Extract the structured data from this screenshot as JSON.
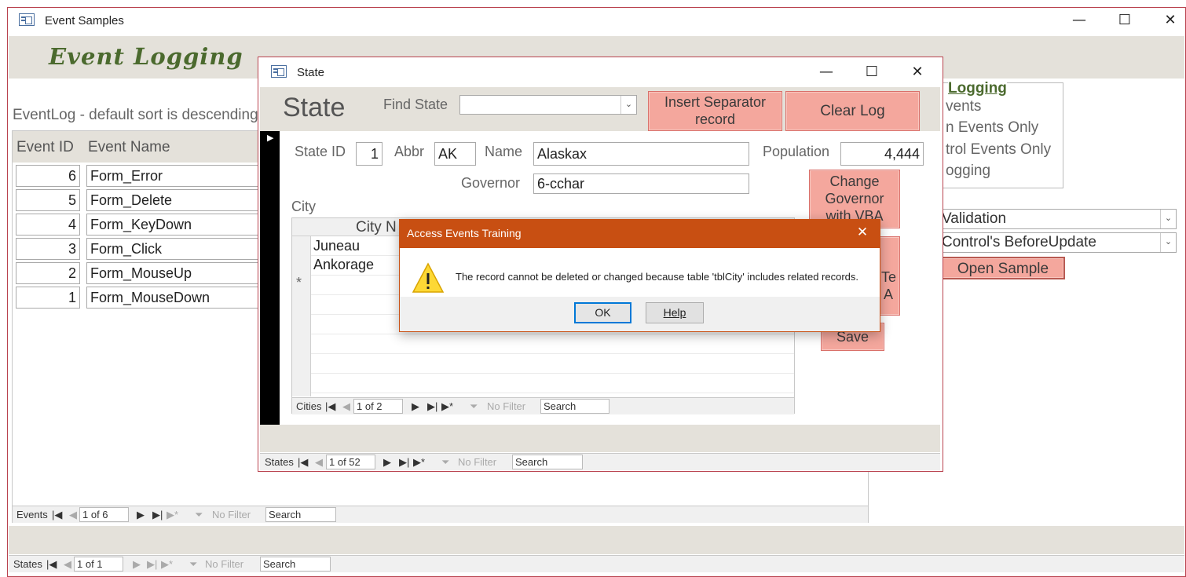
{
  "main_window": {
    "title": "Event Samples",
    "minimize": "—",
    "maximize": "☐",
    "close": "✕",
    "header_title": "Event Logging",
    "eventlog_caption": "EventLog - default sort is descending",
    "columns": [
      "Event ID",
      "Event Name"
    ],
    "rows": [
      {
        "id": "6",
        "name": "Form_Error"
      },
      {
        "id": "5",
        "name": "Form_Delete"
      },
      {
        "id": "4",
        "name": "Form_KeyDown"
      },
      {
        "id": "3",
        "name": "Form_Click"
      },
      {
        "id": "2",
        "name": "Form_MouseUp"
      },
      {
        "id": "1",
        "name": "Form_MouseDown"
      }
    ],
    "events_nav": {
      "label": "Events",
      "record": "1 of 6",
      "filter": "No Filter",
      "search": "Search"
    },
    "states_nav": {
      "label": "States",
      "record": "1 of 1",
      "filter": "No Filter",
      "search": "Search"
    },
    "logging_group": {
      "title": "Logging",
      "options": [
        "vents",
        "n Events Only",
        "trol Events Only",
        "ogging"
      ]
    },
    "combo1": "Validation",
    "combo2": "Control's BeforeUpdate",
    "open_sample": "Open Sample"
  },
  "state_window": {
    "title": "State",
    "minimize": "—",
    "maximize": "☐",
    "close": "✕",
    "header": "State",
    "find_label": "Find State",
    "find_value": "",
    "insert_separator": "Insert Separator record",
    "clear_log": "Clear Log",
    "state_id_label": "State ID",
    "state_id": "1",
    "abbr_label": "Abbr",
    "abbr": "AK",
    "name_label": "Name",
    "name": "Alaskax",
    "population_label": "Population",
    "population": "4,444",
    "governor_label": "Governor",
    "governor": "6-cchar",
    "change_governor": "Change Governor with VBA",
    "hidden_btn_text_1": "Te",
    "hidden_btn_text_2": "A",
    "save": "Save",
    "city_label": "City",
    "city_column": "City N",
    "cities": [
      "Juneau",
      "Ankorage"
    ],
    "new_row_marker": "*",
    "cities_nav": {
      "label": "Cities",
      "record": "1 of 2",
      "filter": "No Filter",
      "search": "Search"
    },
    "states_nav": {
      "label": "States",
      "record": "1 of 52",
      "filter": "No Filter",
      "search": "Search"
    }
  },
  "dialog": {
    "title": "Access Events Training",
    "close": "✕",
    "message": "The record cannot be deleted or changed because table 'tblCity' includes related records.",
    "icon": "warning-icon",
    "ok": "OK",
    "help": "Help"
  },
  "colors": {
    "accent_border": "#b9434f",
    "dialog_title_bg": "#c84f12",
    "pink_button": "#f4a79d",
    "header_bg": "#e4e1da"
  }
}
